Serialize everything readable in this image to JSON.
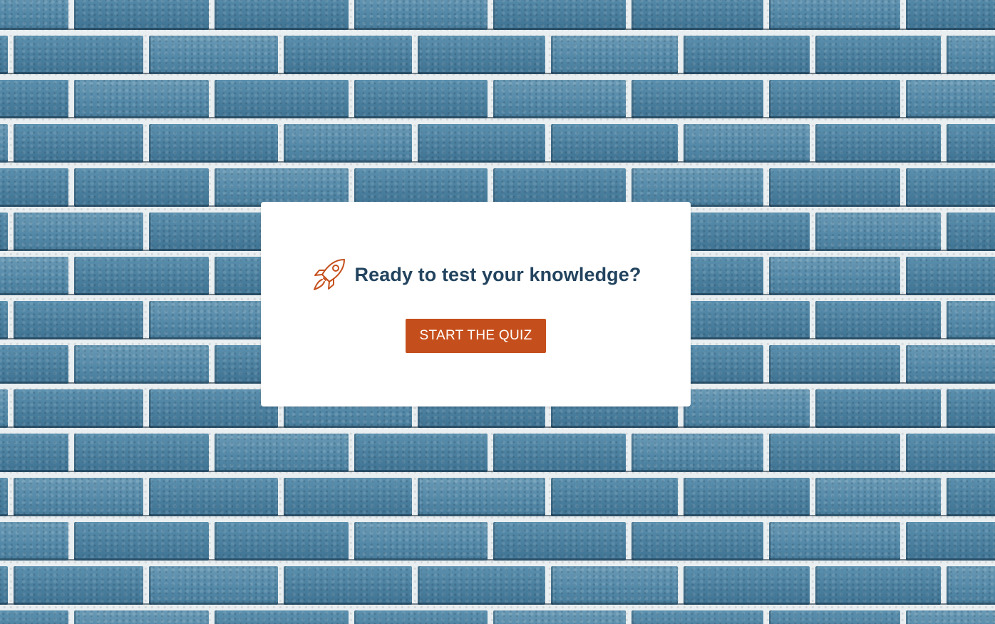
{
  "background": {
    "description_icon": "brick-wall-background",
    "brick_color": "#5089a8",
    "mortar_color": "#e9eef0"
  },
  "card": {
    "icon": "rocket-icon",
    "icon_color": "#c54f1c",
    "heading": "Ready to test your knowledge?",
    "heading_color": "#23445f",
    "start_button_label": "START THE QUIZ",
    "button_color": "#c54f1c"
  }
}
